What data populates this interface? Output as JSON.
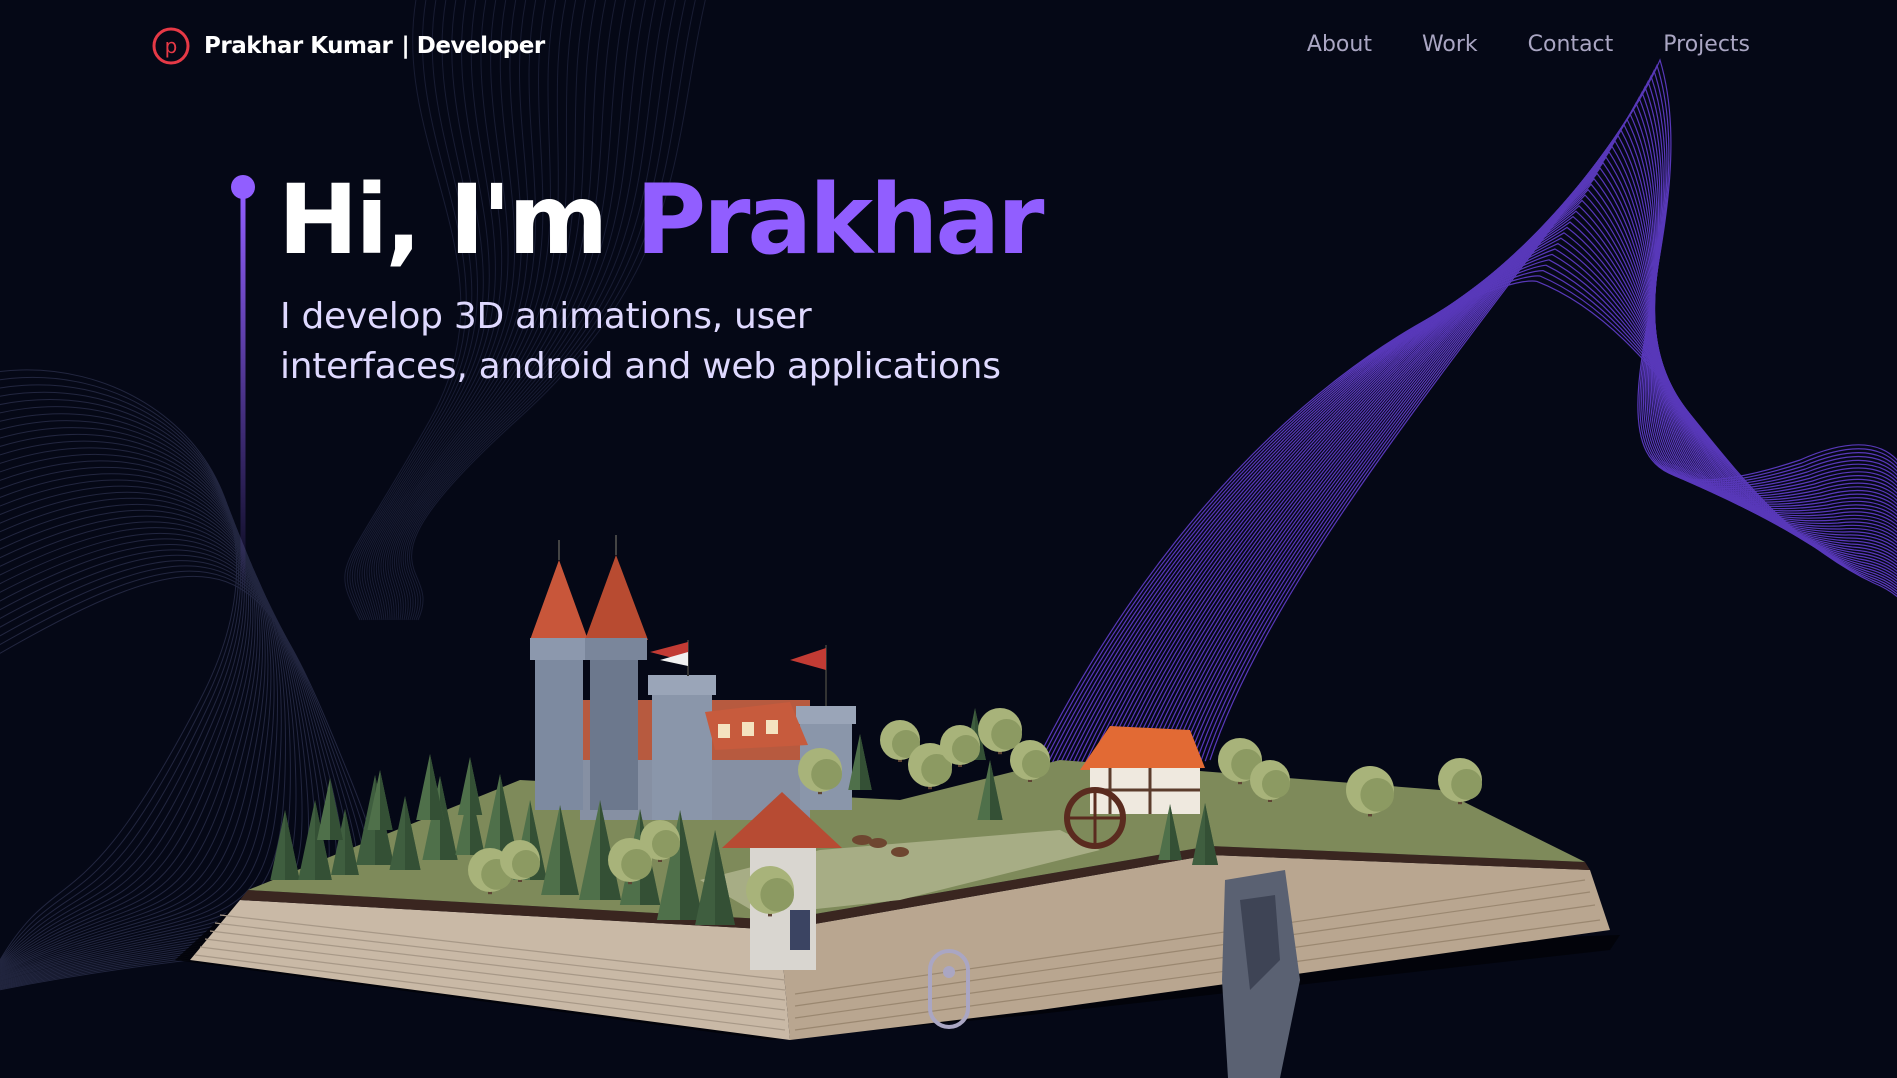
{
  "nav": {
    "logo_letter": "p",
    "brand_name": "Prakhar Kumar",
    "brand_role": "| Developer",
    "links": [
      {
        "label": "About"
      },
      {
        "label": "Work"
      },
      {
        "label": "Contact"
      },
      {
        "label": "Projects"
      }
    ]
  },
  "hero": {
    "greeting": "Hi, I'm",
    "name": "Prakhar",
    "subtitle_line1": "I develop 3D animations, user",
    "subtitle_line2": "interfaces, android and web applications"
  },
  "colors": {
    "background": "#050816",
    "accent": "#915eff",
    "nav_text": "#aaa6c3",
    "logo_red": "#e63946"
  },
  "icons": {
    "logo": "logo-circle-p-icon",
    "scroll": "mouse-scroll-icon"
  }
}
